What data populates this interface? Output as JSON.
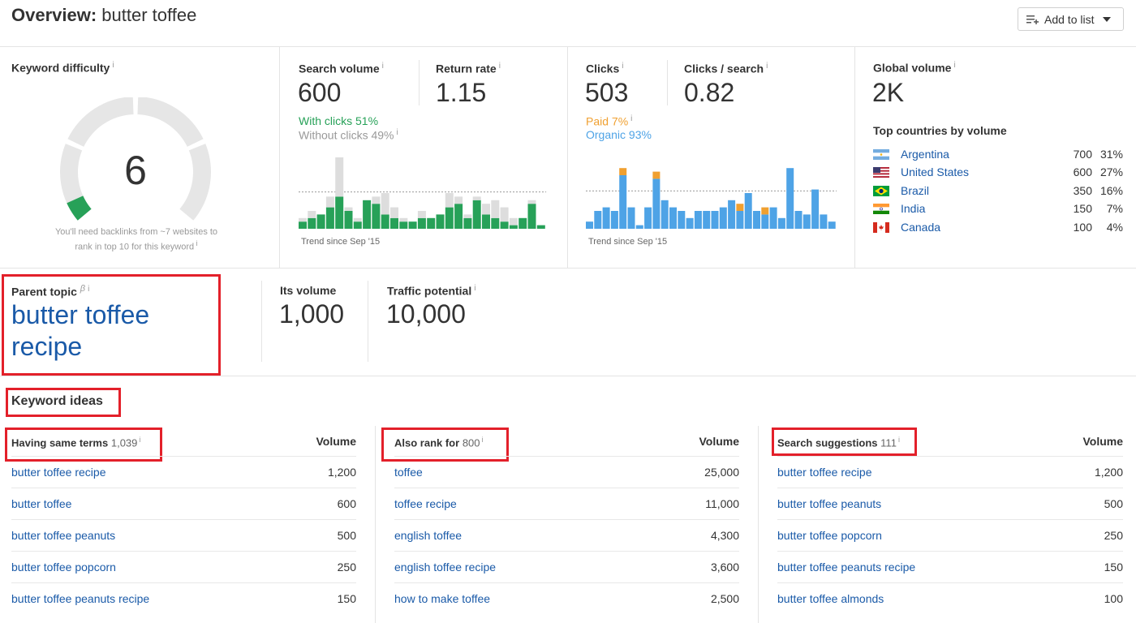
{
  "header": {
    "title_prefix": "Overview:",
    "keyword": "butter toffee",
    "add_to_list": "Add to list"
  },
  "keyword_difficulty": {
    "label": "Keyword difficulty",
    "value": "6",
    "level": 6,
    "note_line1": "You'll need backlinks from ~7 websites to",
    "note_line2": "rank in top 10 for this keyword"
  },
  "search_volume": {
    "label": "Search volume",
    "value": "600",
    "with_clicks": "With clicks 51%",
    "without_clicks": "Without clicks 49%",
    "trend_label": "Trend since Sep '15"
  },
  "return_rate": {
    "label": "Return rate",
    "value": "1.15"
  },
  "clicks": {
    "label": "Clicks",
    "value": "503",
    "paid": "Paid 7%",
    "organic": "Organic 93%",
    "trend_label": "Trend since Sep '15"
  },
  "clicks_per_search": {
    "label": "Clicks / search",
    "value": "0.82"
  },
  "global_volume": {
    "label": "Global volume",
    "value": "2K",
    "top_countries_label": "Top countries by volume",
    "countries": [
      {
        "name": "Argentina",
        "volume": "700",
        "pct": "31%",
        "flag": "argentina"
      },
      {
        "name": "United States",
        "volume": "600",
        "pct": "27%",
        "flag": "usa"
      },
      {
        "name": "Brazil",
        "volume": "350",
        "pct": "16%",
        "flag": "brazil"
      },
      {
        "name": "India",
        "volume": "150",
        "pct": "7%",
        "flag": "india"
      },
      {
        "name": "Canada",
        "volume": "100",
        "pct": "4%",
        "flag": "canada"
      }
    ]
  },
  "parent_topic": {
    "label": "Parent topic",
    "beta": "β",
    "topic": "butter toffee recipe",
    "its_volume_label": "Its volume",
    "its_volume": "1,000",
    "traffic_potential_label": "Traffic potential",
    "traffic_potential": "10,000"
  },
  "keyword_ideas": {
    "label": "Keyword ideas",
    "columns": [
      {
        "title": "Having same terms",
        "count": "1,039",
        "volume_label": "Volume",
        "rows": [
          {
            "keyword": "butter toffee recipe",
            "volume": "1,200"
          },
          {
            "keyword": "butter toffee",
            "volume": "600"
          },
          {
            "keyword": "butter toffee peanuts",
            "volume": "500"
          },
          {
            "keyword": "butter toffee popcorn",
            "volume": "250"
          },
          {
            "keyword": "butter toffee peanuts recipe",
            "volume": "150"
          }
        ]
      },
      {
        "title": "Also rank for",
        "count": "800",
        "volume_label": "Volume",
        "rows": [
          {
            "keyword": "toffee",
            "volume": "25,000"
          },
          {
            "keyword": "toffee recipe",
            "volume": "11,000"
          },
          {
            "keyword": "english toffee",
            "volume": "4,300"
          },
          {
            "keyword": "english toffee recipe",
            "volume": "3,600"
          },
          {
            "keyword": "how to make toffee",
            "volume": "2,500"
          }
        ]
      },
      {
        "title": "Search suggestions",
        "count": "111",
        "volume_label": "Volume",
        "rows": [
          {
            "keyword": "butter toffee recipe",
            "volume": "1,200"
          },
          {
            "keyword": "butter toffee peanuts",
            "volume": "500"
          },
          {
            "keyword": "butter toffee popcorn",
            "volume": "250"
          },
          {
            "keyword": "butter toffee peanuts recipe",
            "volume": "150"
          },
          {
            "keyword": "butter toffee almonds",
            "volume": "100"
          }
        ]
      }
    ]
  },
  "colors": {
    "link": "#1a5aa8",
    "green": "#27a158",
    "orange": "#f0a030",
    "blue": "#4ea3e6",
    "gray_bar": "#dddddd",
    "highlight": "#e3202a"
  },
  "chart_data": [
    {
      "type": "bar",
      "stacked": true,
      "series": [
        {
          "name": "With clicks",
          "values": [
            2,
            3,
            4,
            6,
            9,
            5,
            2,
            8,
            7,
            4,
            3,
            2,
            2,
            3,
            3,
            4,
            6,
            7,
            3,
            8,
            4,
            3,
            2,
            1,
            3,
            7,
            1
          ]
        },
        {
          "name": "Without clicks",
          "values": [
            1,
            2,
            0,
            3,
            11,
            1,
            1,
            0,
            2,
            6,
            3,
            1,
            0,
            2,
            0,
            0,
            4,
            2,
            1,
            1,
            3,
            5,
            4,
            2,
            0,
            1,
            0
          ]
        }
      ]
    },
    {
      "type": "bar",
      "stacked": true,
      "series": [
        {
          "name": "Organic",
          "values": [
            2,
            5,
            6,
            5,
            15,
            6,
            1,
            6,
            14,
            8,
            6,
            5,
            3,
            5,
            5,
            5,
            6,
            8,
            5,
            10,
            5,
            4,
            6,
            3,
            17,
            5,
            4,
            11,
            4,
            2
          ]
        },
        {
          "name": "Paid",
          "values": [
            0,
            0,
            0,
            0,
            2,
            0,
            0,
            0,
            2,
            0,
            0,
            0,
            0,
            0,
            0,
            0,
            0,
            0,
            2,
            0,
            0,
            2,
            0,
            0,
            0,
            0,
            0,
            0,
            0,
            0
          ]
        }
      ]
    }
  ]
}
